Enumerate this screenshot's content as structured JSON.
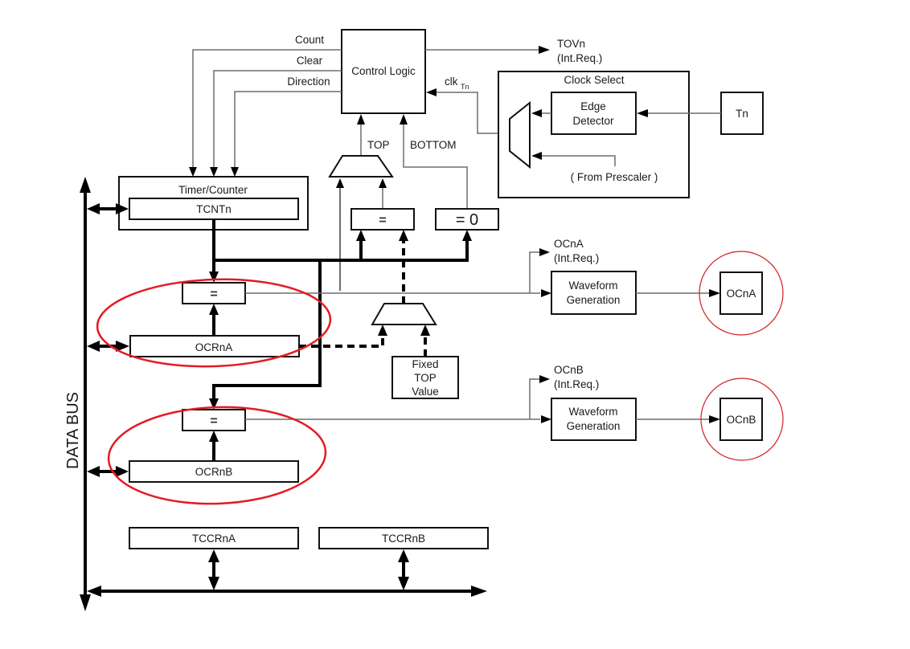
{
  "diagram": {
    "type": "block-diagram",
    "subject": "8-bit Timer/Counter block diagram",
    "annotation_color": "#e41b23",
    "labels": {
      "count": "Count",
      "clear": "Clear",
      "direction": "Direction",
      "control_logic": "Control Logic",
      "tovn": "TOVn",
      "tovn_int": "(Int.Req.)",
      "clk": "clk",
      "clk_sub": "Tn",
      "clock_select": "Clock Select",
      "edge_detector_line1": "Edge",
      "edge_detector_line2": "Detector",
      "from_prescaler": "( From Prescaler )",
      "tn": "Tn",
      "top": "TOP",
      "bottom": "BOTTOM",
      "timer_counter": "Timer/Counter",
      "tcntn": "TCNTn",
      "eq_top": "=",
      "eq_zero": "= 0",
      "eq_a": "=",
      "eq_b": "=",
      "ocrna": "OCRnA",
      "ocrnb": "OCRnB",
      "fixed_top_line1": "Fixed",
      "fixed_top_line2": "TOP",
      "fixed_top_line3": "Value",
      "ocna_int_line1": "OCnA",
      "ocna_int_line2": "(Int.Req.)",
      "ocnb_int_line1": "OCnB",
      "ocnb_int_line2": "(Int.Req.)",
      "waveform_line1": "Waveform",
      "waveform_line2": "Generation",
      "ocna_pin": "OCnA",
      "ocnb_pin": "OCnB",
      "tccrna": "TCCRnA",
      "tccrnb": "TCCRnB",
      "data_bus": "DATA BUS"
    },
    "highlighted": [
      "OCRnA compare unit",
      "OCRnB compare unit",
      "OCnA pin",
      "OCnB pin"
    ]
  }
}
